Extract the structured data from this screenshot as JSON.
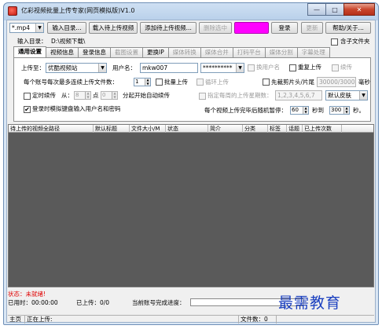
{
  "window": {
    "title": "亿彩视频批量上传专家(网页模拟版)V1.0",
    "min_glyph": "—",
    "max_glyph": "□",
    "close_glyph": "✕"
  },
  "toolbar": {
    "format_value": "*.mp4",
    "btn_import_dir": "输入目录...",
    "btn_load_pending": "载入待上传视频",
    "btn_add_pending": "添加待上传视频...",
    "btn_delete_selected": "删除选中",
    "btn_magenta": "",
    "btn_login": "登录",
    "btn_update": "更新",
    "btn_help": "帮助/关于..."
  },
  "dir_row": {
    "label": "输入目录：",
    "value": "D:\\视频下载\\",
    "subfolder_label": "含子文件夹"
  },
  "tabs": [
    "通用设置",
    "视频信息",
    "登录信息",
    "截图设置",
    "更换IP",
    "媒体转换",
    "媒体合并",
    "打码平台",
    "媒体分割",
    "字幕处理"
  ],
  "general": {
    "upload_to_label": "上传至：",
    "upload_to_value": "优酷视频站",
    "username_label": "用户名：",
    "username_value": "mkw007",
    "password_value": "**********",
    "use_username_label": "换用户名",
    "retry_label": "重复上传",
    "resume_label": "续传",
    "per_account_label": "每个账号每次最多连续上传文件数：",
    "per_account_value": "1",
    "batch_upload_label": "批量上传",
    "loop_upload_label": "循环上传",
    "clip_head_tail_label": "先裁剪片头/片尾",
    "clip_value": "30000/30000",
    "ms_label": "毫秒",
    "timer_label": "定时续传",
    "from_label": "从：",
    "hour_value": "8",
    "point_label": "点",
    "minute_value": "0",
    "auto_resume_label": "分起开始自动续传",
    "weekday_label": "指定每周的上传星期数：",
    "weekday_value": "1,2,3,4,5,6,7",
    "skin_value": "默认皮肤",
    "keyboard_login_label": "登录时模拟键盘输入用户名和密码",
    "pause_label": "每个视频上传完毕后随机暂停：",
    "pause_from_value": "60",
    "sec_to_label": "秒到",
    "pause_to_value": "300",
    "sec_label": "秒。"
  },
  "list": {
    "columns": [
      "待上传的视频全路径",
      "默认标题",
      "文件大小/M",
      "状态",
      "简介",
      "分类",
      "标签",
      "话题",
      "已上传次数"
    ]
  },
  "status": {
    "state_text": "状态：未就绪!",
    "elapsed": "已用时：00:00:00",
    "uploaded": "已上传：0/0",
    "progress_label": "当前账号完成进度：",
    "progress_value": 0,
    "home_label": "主页",
    "uploading_label": "正在上传:",
    "file_count": "文件数：0"
  },
  "watermark": "最需教育"
}
